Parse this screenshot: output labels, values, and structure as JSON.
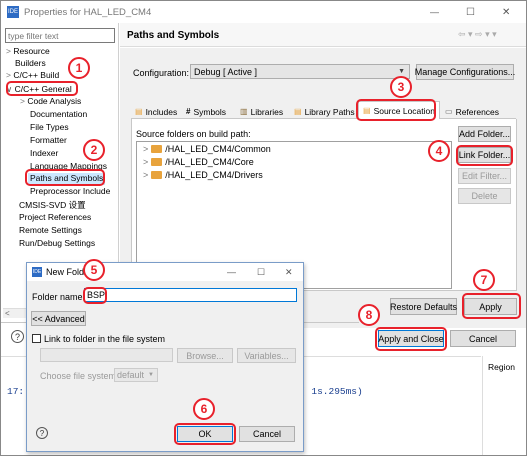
{
  "window": {
    "title": "Properties for HAL_LED_CM4",
    "min": "—",
    "max": "☐",
    "close": "✕"
  },
  "filter": {
    "placeholder": "type filter text"
  },
  "left_tree": [
    {
      "label": "Resource",
      "prefix": ">"
    },
    {
      "label": "Builders",
      "prefix": ""
    },
    {
      "label": "C/C++ Build",
      "prefix": ">"
    },
    {
      "label": "C/C++ General",
      "prefix": "∨"
    },
    {
      "label": "Code Analysis",
      "prefix": ">"
    },
    {
      "label": "Documentation",
      "prefix": ""
    },
    {
      "label": "File Types",
      "prefix": ""
    },
    {
      "label": "Formatter",
      "prefix": ""
    },
    {
      "label": "Indexer",
      "prefix": ""
    },
    {
      "label": "Language Mappings",
      "prefix": ""
    },
    {
      "label": "Paths and Symbols",
      "prefix": ""
    },
    {
      "label": "Preprocessor Include",
      "prefix": ""
    },
    {
      "label": "CMSIS-SVD 设置",
      "prefix": ""
    },
    {
      "label": "Project References",
      "prefix": ""
    },
    {
      "label": "Remote Settings",
      "prefix": ""
    },
    {
      "label": "Run/Debug Settings",
      "prefix": ""
    }
  ],
  "panel": {
    "title": "Paths and Symbols",
    "config_label": "Configuration:",
    "config_value": "Debug  [ Active ]",
    "manage_button": "Manage Configurations...",
    "tabs": [
      "Includes",
      "Symbols",
      "Libraries",
      "Library Paths",
      "Source Location",
      "References"
    ],
    "tab_icons": [
      "📂",
      "#",
      "📚",
      "📂",
      "📂",
      "📄"
    ],
    "source_label": "Source folders on build path:",
    "folders": [
      "/HAL_LED_CM4/Common",
      "/HAL_LED_CM4/Core",
      "/HAL_LED_CM4/Drivers"
    ],
    "side_buttons": [
      "Add Folder...",
      "Link Folder...",
      "Edit Filter...",
      "Delete"
    ],
    "restore_button": "Restore Defaults",
    "apply_button": "Apply",
    "apply_close_button": "Apply and Close",
    "cancel_button": "Cancel"
  },
  "background": {
    "console_line": "17:",
    "console_tail": "( 1s.295ms)",
    "region": "Region"
  },
  "dialog": {
    "title": "New Folder",
    "folder_name_label": "Folder name:",
    "folder_name_value": "BSP",
    "advanced_button": "<< Advanced",
    "link_checkbox_label": "Link to folder in the file system",
    "browse_button": "Browse...",
    "variables_button": "Variables...",
    "choose_fs_label": "Choose file system:",
    "choose_fs_value": "default",
    "ok_button": "OK",
    "cancel_button": "Cancel",
    "help": "?"
  },
  "annotations": [
    "1",
    "2",
    "3",
    "4",
    "5",
    "6",
    "7",
    "8"
  ],
  "colors": {
    "annotation": "#e8212b",
    "selection": "#cce8ff",
    "accent": "#0078d7",
    "folder": "#e8a33c"
  }
}
